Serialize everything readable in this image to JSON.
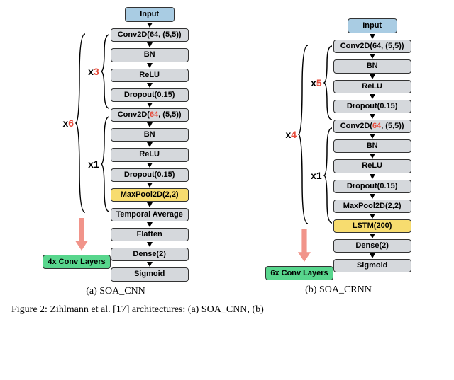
{
  "panelA": {
    "caption": "(a) SOA_CNN",
    "input": "Input",
    "outer_mult_prefix": "x",
    "outer_mult_num": "6",
    "inner1_mult_prefix": "x",
    "inner1_mult_num": "3",
    "inner2_mult_prefix": "x",
    "inner2_mult_num": "1",
    "block1": {
      "conv": "Conv2D(64, (5,5))",
      "bn": "BN",
      "relu": "ReLU",
      "drop": "Dropout(0.15)"
    },
    "block2": {
      "conv_pre": "Conv2D(",
      "conv_ch": "64",
      "conv_post": ", (5,5))",
      "bn": "BN",
      "relu": "ReLU",
      "drop": "Dropout(0.15)",
      "pool": "MaxPool2D(2,2)"
    },
    "tail": {
      "tempavg": "Temporal Average",
      "flatten": "Flatten",
      "dense": "Dense(2)",
      "sigmoid": "Sigmoid"
    },
    "convlayers": "4x Conv Layers"
  },
  "panelB": {
    "caption": "(b) SOA_CRNN",
    "input": "Input",
    "outer_mult_prefix": "x",
    "outer_mult_num": "4",
    "inner1_mult_prefix": "x",
    "inner1_mult_num": "5",
    "inner2_mult_prefix": "x",
    "inner2_mult_num": "1",
    "block1": {
      "conv": "Conv2D(64, (5,5))",
      "bn": "BN",
      "relu": "ReLU",
      "drop": "Dropout(0.15)"
    },
    "block2": {
      "conv_pre": "Conv2D(",
      "conv_ch": "64",
      "conv_post": ", (5,5))",
      "bn": "BN",
      "relu": "ReLU",
      "drop": "Dropout(0.15)",
      "pool": "MaxPool2D(2,2)"
    },
    "tail": {
      "lstm": "LSTM(200)",
      "dense": "Dense(2)",
      "sigmoid": "Sigmoid"
    },
    "convlayers": "6x Conv Layers"
  },
  "figcaption": "Figure 2: Zihlmann et al. [17] architectures: (a) SOA_CNN, (b)",
  "chart_data": [
    {
      "type": "diagram",
      "name": "SOA_CNN",
      "input": "Input",
      "outer_repeat": 6,
      "inner_block_1": {
        "repeat": 3,
        "layers": [
          "Conv2D(64,(5,5))",
          "BN",
          "ReLU",
          "Dropout(0.15)"
        ]
      },
      "inner_block_2": {
        "repeat": 1,
        "layers": [
          "Conv2D(64,(5,5))",
          "BN",
          "ReLU",
          "Dropout(0.15)",
          "MaxPool2D(2,2)"
        ]
      },
      "tail": [
        "Temporal Average",
        "Flatten",
        "Dense(2)",
        "Sigmoid"
      ],
      "note_depth_doubles": "4x Conv Layers"
    },
    {
      "type": "diagram",
      "name": "SOA_CRNN",
      "input": "Input",
      "outer_repeat": 4,
      "inner_block_1": {
        "repeat": 5,
        "layers": [
          "Conv2D(64,(5,5))",
          "BN",
          "ReLU",
          "Dropout(0.15)"
        ]
      },
      "inner_block_2": {
        "repeat": 1,
        "layers": [
          "Conv2D(64,(5,5))",
          "BN",
          "ReLU",
          "Dropout(0.15)",
          "MaxPool2D(2,2)"
        ]
      },
      "tail": [
        "LSTM(200)",
        "Dense(2)",
        "Sigmoid"
      ],
      "note_depth_doubles": "6x Conv Layers"
    }
  ]
}
